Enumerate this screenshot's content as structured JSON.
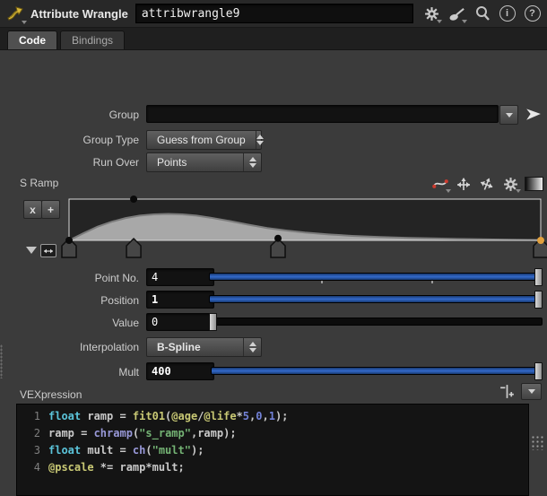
{
  "window": {
    "title": "Attribute Wrangle parameter pane"
  },
  "colors": {
    "panel": "#3b3b3b",
    "accent_blue": "#3166c4",
    "selected_point": "#e2a13e",
    "ramp_fill": "#a8a8a8",
    "ramp_bg": "#242424"
  },
  "header": {
    "node_type": "Attribute Wrangle",
    "node_name": "attribwrangle9",
    "info_glyph": "i",
    "help_glyph": "?"
  },
  "tabs": [
    {
      "label": "Code",
      "active": true
    },
    {
      "label": "Bindings",
      "active": false
    }
  ],
  "params": {
    "group": {
      "label": "Group",
      "value": "",
      "bold": false
    },
    "group_type": {
      "label": "Group Type",
      "value": "Guess from Group",
      "bold": false
    },
    "run_over": {
      "label": "Run Over",
      "value": "Points",
      "bold": false
    },
    "point_no": {
      "label": "Point No.",
      "value": "4",
      "bold": false,
      "slider": {
        "fraction": 1,
        "filled": true,
        "ticks": [
          0.337,
          0.667
        ]
      }
    },
    "position": {
      "label": "Position",
      "value": "1",
      "bold": true,
      "slider": {
        "fraction": 1,
        "filled": true,
        "ticks": []
      }
    },
    "value": {
      "label": "Value",
      "value": "0",
      "bold": false,
      "slider": {
        "fraction": 0,
        "filled": false,
        "ticks": []
      }
    },
    "interpolation": {
      "label": "Interpolation",
      "value": "B-Spline",
      "bold": true
    },
    "mult": {
      "label": "Mult",
      "value": "400",
      "bold": true,
      "slider": {
        "fraction": 1,
        "filled": true,
        "ticks": []
      }
    }
  },
  "ramp": {
    "label": "S Ramp",
    "remove_label": "x",
    "add_label": "+",
    "selected_point_number": 4,
    "points": [
      {
        "pos": 0.0,
        "value": 0.0,
        "selected": false
      },
      {
        "pos": 0.137,
        "value": 1.0,
        "selected": false
      },
      {
        "pos": 0.443,
        "value": 0.05,
        "selected": false
      },
      {
        "pos": 1.0,
        "value": 0.0,
        "selected": true
      }
    ],
    "curve_samples": [
      [
        0,
        0
      ],
      [
        0.03,
        0.17
      ],
      [
        0.06,
        0.33
      ],
      [
        0.09,
        0.45
      ],
      [
        0.12,
        0.54
      ],
      [
        0.15,
        0.6
      ],
      [
        0.18,
        0.63
      ],
      [
        0.21,
        0.64
      ],
      [
        0.24,
        0.63
      ],
      [
        0.27,
        0.6
      ],
      [
        0.3,
        0.55
      ],
      [
        0.34,
        0.47
      ],
      [
        0.38,
        0.38
      ],
      [
        0.42,
        0.3
      ],
      [
        0.46,
        0.24
      ],
      [
        0.5,
        0.19
      ],
      [
        0.55,
        0.145
      ],
      [
        0.6,
        0.11
      ],
      [
        0.66,
        0.082
      ],
      [
        0.72,
        0.06
      ],
      [
        0.78,
        0.045
      ],
      [
        0.84,
        0.032
      ],
      [
        0.9,
        0.022
      ],
      [
        0.95,
        0.014
      ],
      [
        1.0,
        0.008
      ]
    ]
  },
  "vex": {
    "label": "VEXpression",
    "lines": [
      {
        "no": "1",
        "tokens": [
          [
            "float",
            "c"
          ],
          [
            " ramp = ",
            "w"
          ],
          [
            "fit01",
            "y"
          ],
          [
            "(",
            "w"
          ],
          [
            "@age",
            "y"
          ],
          [
            "/",
            "w"
          ],
          [
            "@life",
            "y"
          ],
          [
            "*",
            "w"
          ],
          [
            "5",
            "n"
          ],
          [
            ",",
            "w"
          ],
          [
            "0",
            "n"
          ],
          [
            ",",
            "w"
          ],
          [
            "1",
            "n"
          ],
          [
            ");",
            "w"
          ]
        ]
      },
      {
        "no": "2",
        "tokens": [
          [
            "ramp = ",
            "w"
          ],
          [
            "chramp",
            "p"
          ],
          [
            "(",
            "w"
          ],
          [
            "\"s_ramp\"",
            "g"
          ],
          [
            ",ramp);",
            "w"
          ]
        ]
      },
      {
        "no": "3",
        "tokens": [
          [
            "float",
            "c"
          ],
          [
            " mult = ",
            "w"
          ],
          [
            "ch",
            "p"
          ],
          [
            "(",
            "w"
          ],
          [
            "\"mult\"",
            "g"
          ],
          [
            ");",
            "w"
          ]
        ]
      },
      {
        "no": "4",
        "tokens": [
          [
            "@pscale",
            "y"
          ],
          [
            " *= ramp*mult;",
            "w"
          ]
        ]
      }
    ]
  }
}
